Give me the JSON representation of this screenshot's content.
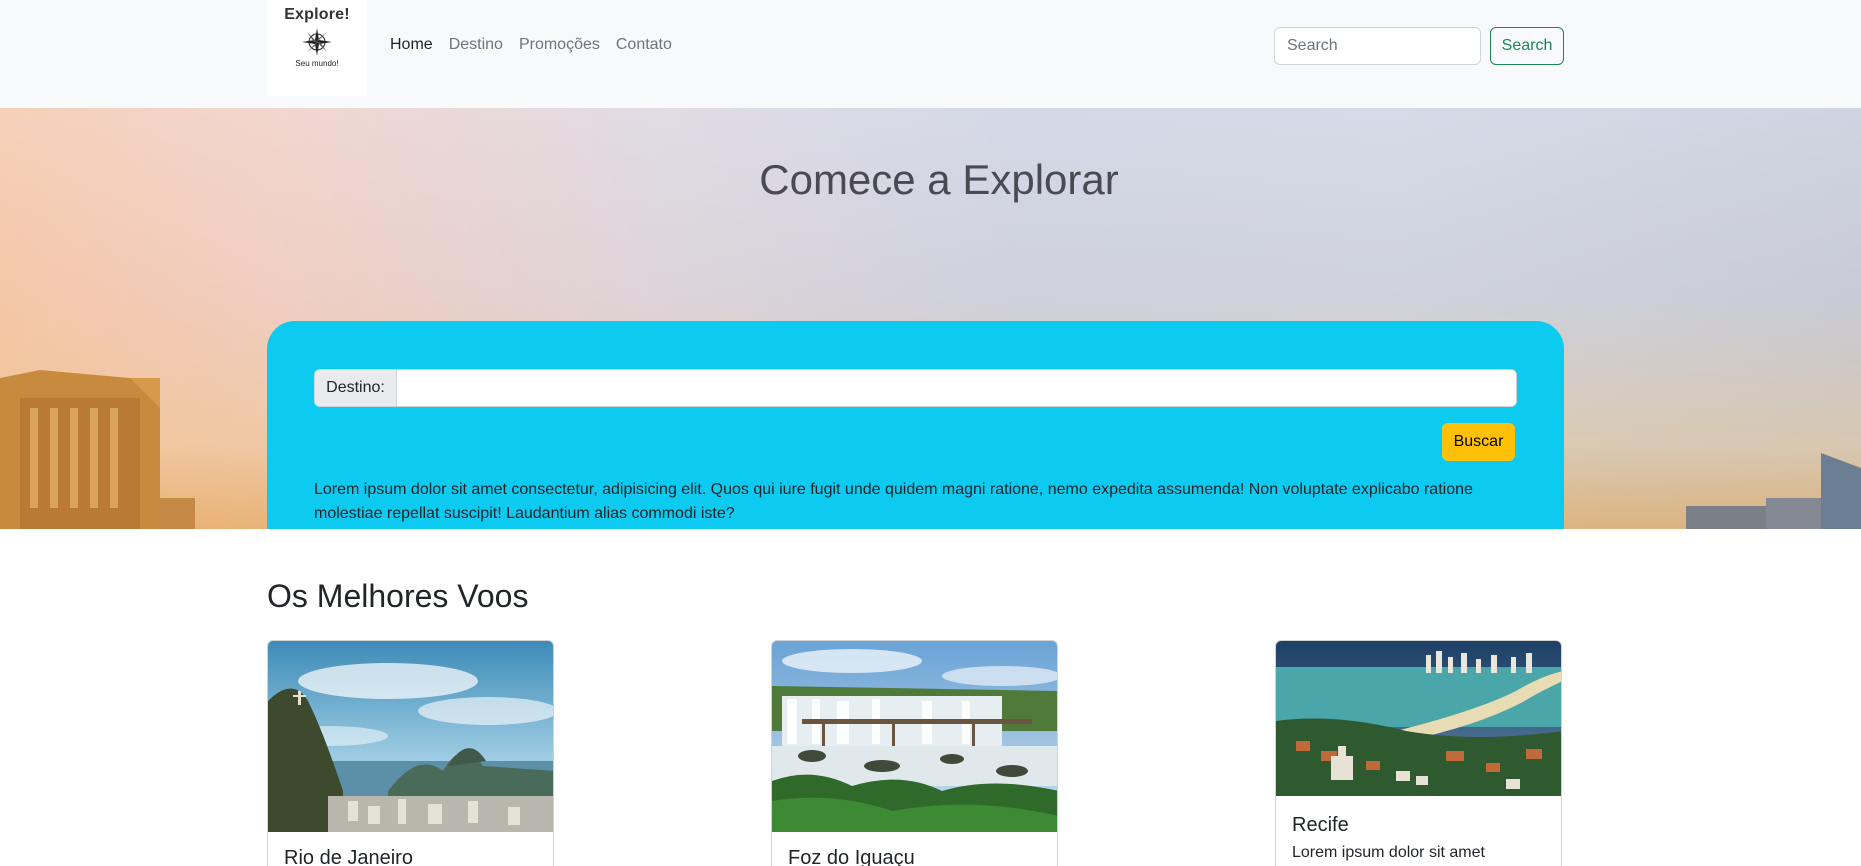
{
  "navbar": {
    "brand": {
      "title": "Explore!",
      "tagline": "Seu mundo!"
    },
    "links": [
      {
        "label": "Home",
        "active": true
      },
      {
        "label": "Destino",
        "active": false
      },
      {
        "label": "Promoções",
        "active": false
      },
      {
        "label": "Contato",
        "active": false
      }
    ],
    "search": {
      "placeholder": "Search",
      "button_label": "Search"
    }
  },
  "hero": {
    "title": "Comece a Explorar",
    "destination_label": "Destino:",
    "destination_value": "",
    "buscar_label": "Buscar",
    "description": "Lorem ipsum dolor sit amet consectetur, adipisicing elit. Quos qui iure fugit unde quidem magni ratione, nemo expedita assumenda! Non voluptate explicabo ratione molestiae repellat suscipit! Laudantium alias commodi iste?"
  },
  "flights": {
    "title": "Os Melhores Voos",
    "cards": [
      {
        "title": "Rio de Janeiro",
        "text": ""
      },
      {
        "title": "Foz do Iguaçu",
        "text": ""
      },
      {
        "title": "Recife",
        "text": "Lorem ipsum dolor sit amet"
      }
    ]
  },
  "colors": {
    "panel": "#0dcaf0",
    "buscar": "#ffc107",
    "search_outline": "#198754"
  }
}
